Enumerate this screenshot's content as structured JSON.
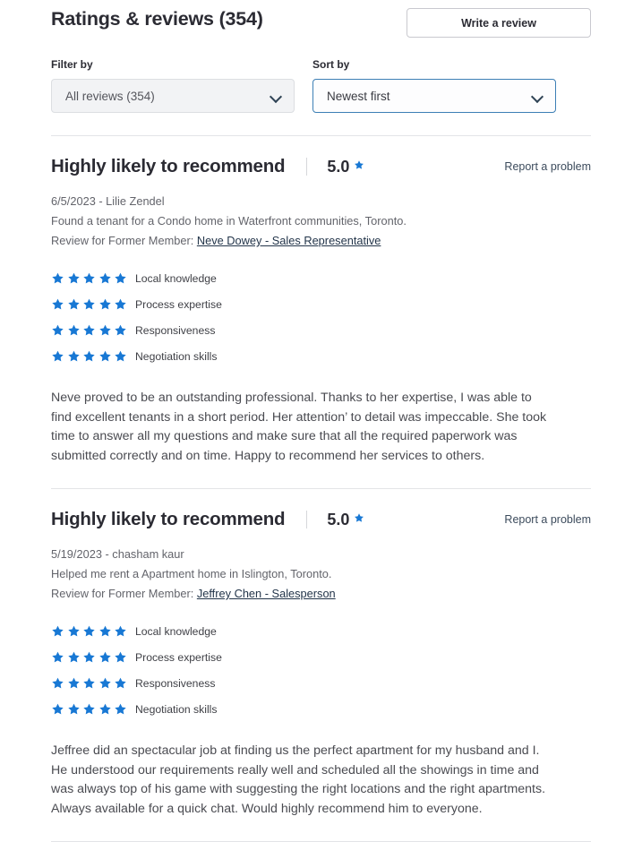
{
  "header": {
    "title": "Ratings & reviews (354)",
    "write_review_label": "Write a review"
  },
  "controls": {
    "filter": {
      "label": "Filter by",
      "value": "All reviews (354)",
      "chevron_icon": "chevron-down-icon"
    },
    "sort": {
      "label": "Sort by",
      "value": "Newest first",
      "chevron_icon": "chevron-down-icon"
    }
  },
  "colors": {
    "star_blue": "#1878d4",
    "focus_border": "#3d7fb5",
    "divider": "#e3e4e7"
  },
  "rating_categories": [
    "Local knowledge",
    "Process expertise",
    "Responsiveness",
    "Negotiation skills"
  ],
  "reviews": [
    {
      "title": "Highly likely to recommend",
      "score": "5.0",
      "star_icon": "star-icon",
      "report_label": "Report a problem",
      "date_author": "6/5/2023 - Lilie Zendel",
      "transaction": "Found a tenant for a Condo home in Waterfront communities, Toronto.",
      "review_for_prefix": "Review for Former Member:",
      "agent": "Neve Dowey - Sales Representative",
      "stars": [
        5,
        5,
        5,
        5
      ],
      "body": "Neve proved to be an outstanding professional. Thanks to her expertise, I was able to find excellent tenants in a short period. Her attention’ to detail was impeccable. She took time to answer all my questions and make sure that all the required paperwork was submitted correctly and on time. Happy to recommend her services to others."
    },
    {
      "title": "Highly likely to recommend",
      "score": "5.0",
      "star_icon": "star-icon",
      "report_label": "Report a problem",
      "date_author": "5/19/2023 - chasham kaur",
      "transaction": "Helped me rent a Apartment home in Islington, Toronto.",
      "review_for_prefix": "Review for Former Member:",
      "agent": "Jeffrey Chen - Salesperson",
      "stars": [
        5,
        5,
        5,
        5
      ],
      "body": "Jeffree did an spectacular job at finding us the perfect apartment for my husband and I. He understood our requirements really well and scheduled all the showings in time and was always top of his game with suggesting the right locations and the right apartments. Always available for a quick chat. Would highly recommend him to everyone."
    }
  ]
}
